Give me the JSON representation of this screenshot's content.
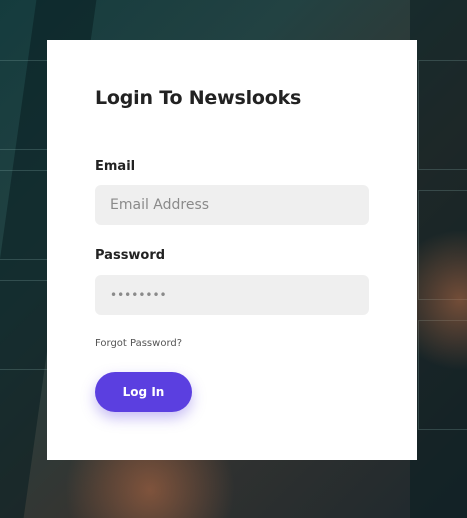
{
  "login": {
    "title": "Login To Newslooks",
    "email_label": "Email",
    "email_placeholder": "Email Address",
    "password_label": "Password",
    "password_placeholder": "••••••••",
    "forgot_link": "Forgot Password?",
    "submit_label": "Log In"
  },
  "colors": {
    "accent": "#5b3fe0",
    "field_bg": "#efefef",
    "card_bg": "#ffffff"
  }
}
